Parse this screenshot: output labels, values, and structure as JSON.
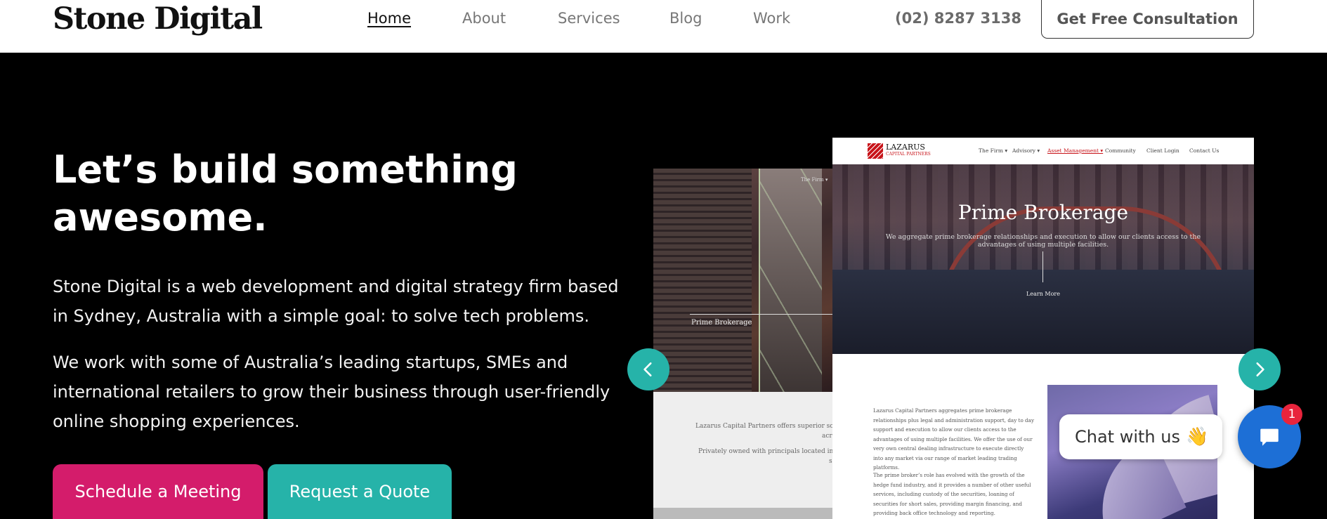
{
  "header": {
    "logo": "Stone Digital",
    "nav": [
      {
        "label": "Home",
        "active": true
      },
      {
        "label": "About"
      },
      {
        "label": "Services"
      },
      {
        "label": "Blog"
      },
      {
        "label": "Work"
      }
    ],
    "phone": "(02) 8287 3138",
    "cta_label": "Get Free Consultation"
  },
  "hero": {
    "title": "Let’s build something awesome.",
    "paragraph1": "Stone Digital is a web development and digital strategy firm based in Sydney, Australia with a simple goal: to solve tech problems.",
    "paragraph2": "We work with some of Australia’s leading startups, SMEs and international retailers to grow their business through user-friendly online shopping experiences.",
    "primary_button": "Schedule a Meeting",
    "secondary_button": "Request a Quote"
  },
  "slider": {
    "back_slide": {
      "nav_item": "The Firm ▾",
      "caption": "Prime Brokerage",
      "text1": "Lazarus Capital Partners offers superior solutions",
      "text1b": "acr",
      "text2": "Privately owned with principals located internati",
      "text2b": "s"
    },
    "front_slide": {
      "logo_name": "LAZARUS",
      "logo_sub": "CAPITAL PARTNERS",
      "nav": [
        "The Firm ▾",
        "Advisory ▾",
        "Asset Management ▾",
        "Community",
        "Client Login",
        "Contact Us"
      ],
      "hero_title": "Prime Brokerage",
      "hero_sub": "We aggregate prime brokerage relationships and execution to allow our clients access to the advantages of using multiple facilities.",
      "learn_more": "Learn More",
      "body1": "Lazarus Capital Partners aggregates prime brokerage relationships plus legal and administration support, day to day support and execution to allow our clients access to the advantages of using multiple facilities. We offer the use of our very own central dealing infrastructure to execute directly into any market via our range of market leading trading platforms.",
      "body2": "The prime broker’s role has evolved with the growth of the hedge fund industry, and it provides a number of other useful services, including custody of the securities, loaning of securities for short sales, providing margin financing, and providing back office technology and reporting."
    },
    "prev_icon": "chevron-left-icon",
    "next_icon": "chevron-right-icon"
  },
  "chat": {
    "label": "Chat with us",
    "emoji": "👋",
    "badge_count": "1"
  },
  "colors": {
    "pink": "#d41c6b",
    "teal": "#26b3a9",
    "chat_blue": "#1d6fd6",
    "badge_red": "#e8243c"
  }
}
